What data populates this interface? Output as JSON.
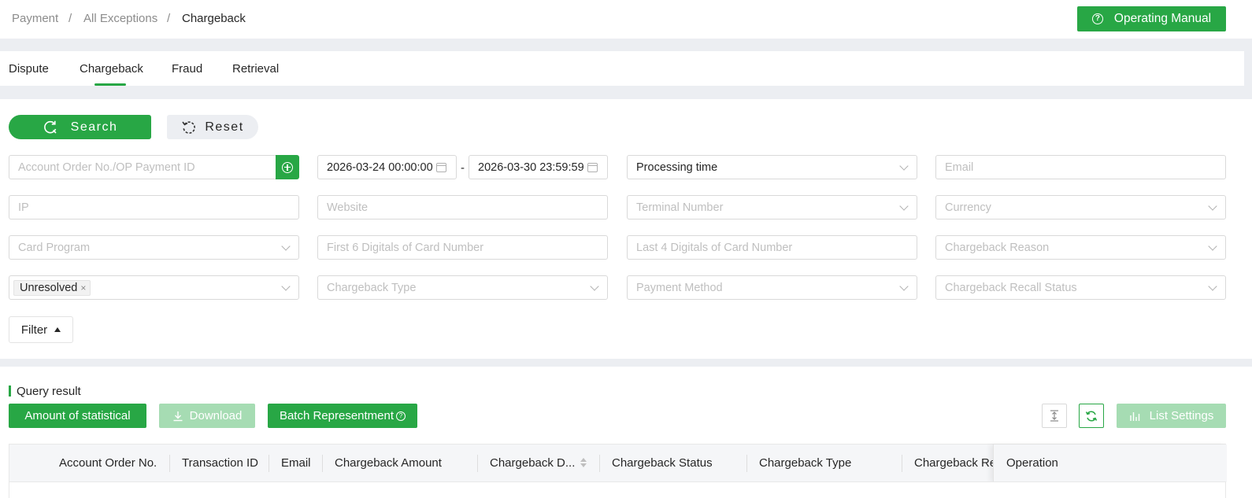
{
  "breadcrumb": {
    "items": [
      "Payment",
      "All Exceptions",
      "Chargeback"
    ],
    "separator": "/"
  },
  "header": {
    "manual_button": "Operating Manual",
    "manual_icon": "?"
  },
  "tabs": [
    {
      "label": "Dispute",
      "active": false
    },
    {
      "label": "Chargeback",
      "active": true
    },
    {
      "label": "Fraud",
      "active": false
    },
    {
      "label": "Retrieval",
      "active": false
    }
  ],
  "actions": {
    "search": "Search",
    "reset": "Reset",
    "filter_toggle": "Filter"
  },
  "filters": {
    "order_id_placeholder": "Account Order No./OP Payment ID",
    "date_start": "2026-03-24 00:00:00",
    "date_separator": "-",
    "date_end": "2026-03-30 23:59:59",
    "time_type": "Processing time",
    "email_placeholder": "Email",
    "ip_placeholder": "IP",
    "website_placeholder": "Website",
    "terminal_placeholder": "Terminal Number",
    "currency_placeholder": "Currency",
    "card_program_placeholder": "Card Program",
    "first6_placeholder": "First 6 Digitals of Card Number",
    "last4_placeholder": "Last 4 Digitals of Card Number",
    "reason_placeholder": "Chargeback Reason",
    "status_tag": "Unresolved",
    "status_tag_close": "×",
    "type_placeholder": "Chargeback Type",
    "payment_method_placeholder": "Payment Method",
    "recall_status_placeholder": "Chargeback Recall Status"
  },
  "results": {
    "title": "Query result",
    "amount_button": "Amount of statistical",
    "download_button": "Download",
    "batch_button": "Batch Representment",
    "batch_icon": "?",
    "list_settings_button": "List Settings",
    "columns": [
      "Account Order No.",
      "Transaction ID",
      "Email",
      "Chargeback Amount",
      "Chargeback D...",
      "Chargeback Status",
      "Chargeback Type",
      "Chargeback Re",
      "Operation"
    ]
  },
  "colors": {
    "primary": "#28a745",
    "primary_disabled": "#a6dcb3",
    "page_bg": "#eceef2"
  }
}
